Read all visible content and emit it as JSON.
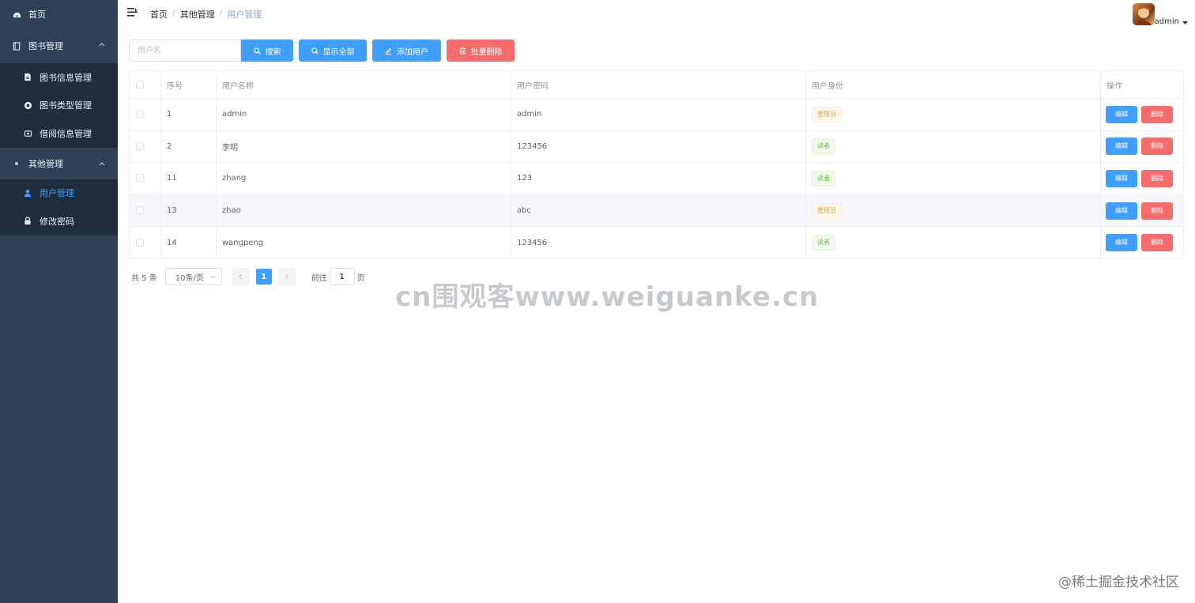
{
  "sidebar": {
    "home": {
      "label": "首页",
      "icon": "dashboard-icon"
    },
    "books_group": {
      "label": "图书管理",
      "icon": "book-icon"
    },
    "book_items": [
      {
        "label": "图书信息管理",
        "icon": "document-icon"
      },
      {
        "label": "图书类型管理",
        "icon": "category-icon"
      },
      {
        "label": "借阅信息管理",
        "icon": "borrow-icon"
      }
    ],
    "other_group": {
      "label": "其他管理",
      "icon": "dot-icon"
    },
    "other_items": [
      {
        "label": "用户管理",
        "icon": "user-icon",
        "active": true
      },
      {
        "label": "修改密码",
        "icon": "lock-icon"
      }
    ]
  },
  "header": {
    "breadcrumb": [
      "首页",
      "其他管理",
      "用户管理"
    ],
    "user_name": "admin"
  },
  "toolbar": {
    "search_placeholder": "用户名",
    "search_value": "",
    "search_label": "搜索",
    "show_all_label": "显示全部",
    "add_label": "添加用户",
    "batch_delete_label": "批量删除"
  },
  "table": {
    "columns": [
      "序号",
      "用户名称",
      "用户密码",
      "用户身份",
      "操作"
    ],
    "rows": [
      {
        "id": "1",
        "name": "admin",
        "password": "admin",
        "role": "管理员",
        "role_type": "warning"
      },
      {
        "id": "2",
        "name": "李明",
        "password": "123456",
        "role": "读者",
        "role_type": "success"
      },
      {
        "id": "11",
        "name": "zhang",
        "password": "123",
        "role": "读者",
        "role_type": "success"
      },
      {
        "id": "13",
        "name": "zhao",
        "password": "abc",
        "role": "管理员",
        "role_type": "warning"
      },
      {
        "id": "14",
        "name": "wangpeng",
        "password": "123456",
        "role": "读者",
        "role_type": "success"
      }
    ],
    "edit_label": "编辑",
    "delete_label": "删除"
  },
  "pagination": {
    "total_text": "共 5 条",
    "page_size": "10条/页",
    "current_page": "1",
    "goto_prefix": "前往",
    "goto_value": "1",
    "goto_suffix": "页"
  },
  "watermark": "cn围观客www.weiguanke.cn",
  "footer_mark": "@稀土掘金技术社区",
  "colors": {
    "sidebar_bg": "#304156",
    "submenu_bg": "#1f2d3d",
    "primary": "#409eff",
    "danger": "#f56c6c",
    "warning": "#e6a23c",
    "success": "#67c23a"
  }
}
